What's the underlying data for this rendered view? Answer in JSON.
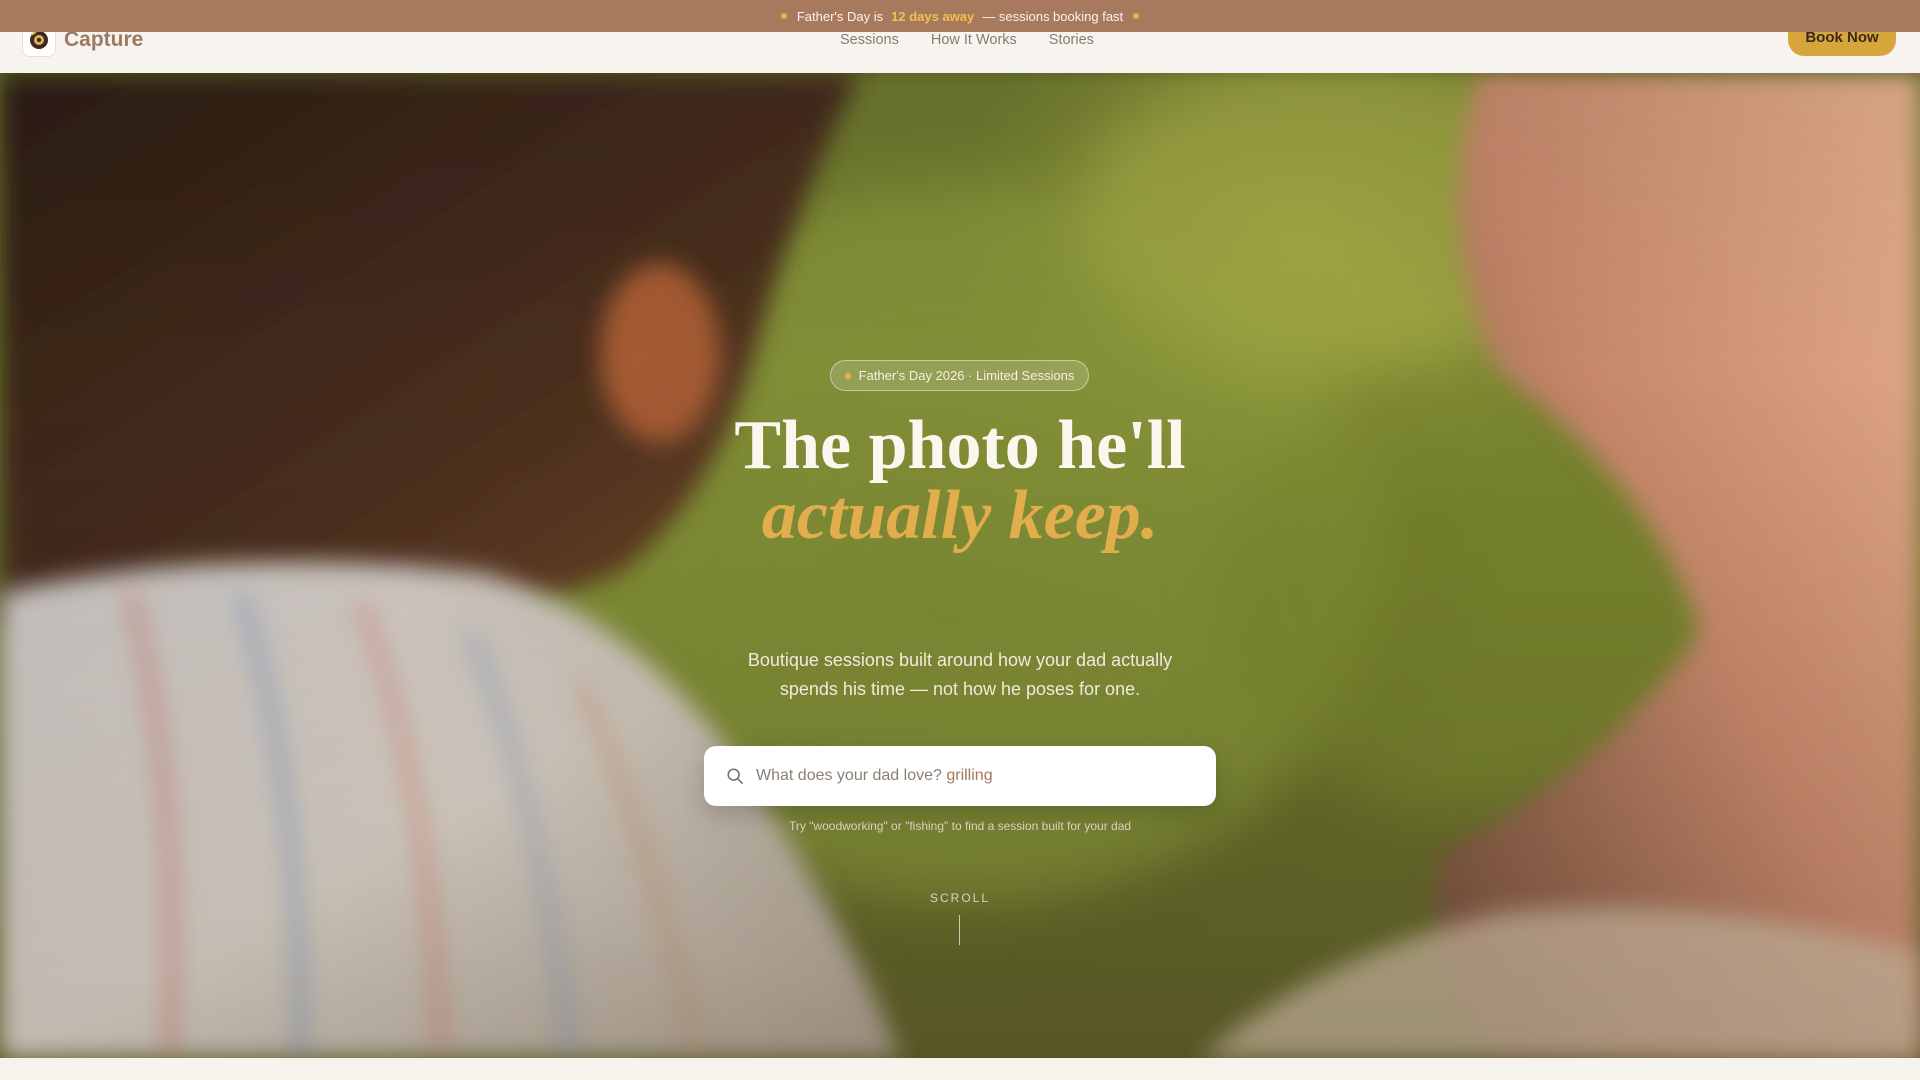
{
  "announcement": {
    "prefix": "Father's Day is",
    "highlight": "12 days away",
    "suffix": "— sessions booking fast"
  },
  "header": {
    "logo_text": "Capture",
    "nav": [
      "Sessions",
      "How It Works",
      "Stories"
    ],
    "cta_label": "Book Now"
  },
  "hero": {
    "badge": "Father's Day 2026 · Limited Sessions",
    "headline_line1": "The photo he'll",
    "headline_line2": "actually keep.",
    "subheadline": "Boutique sessions built around how your dad actually spends his time — not how he poses for one.",
    "search": {
      "prompt": "What does your dad love?",
      "value": "grilling"
    },
    "hint": "Try \"woodworking\" or \"fishing\" to find a session built for your dad",
    "scroll_label": "SCROLL"
  },
  "colors": {
    "announcement_bg": "#a77a5e",
    "accent_gold": "#d6a63a",
    "headline_italic": "#e1ad4d",
    "logo_text": "#9c7a63"
  },
  "icons": [
    "logo-camera-icon",
    "search-icon",
    "dot-icon"
  ]
}
